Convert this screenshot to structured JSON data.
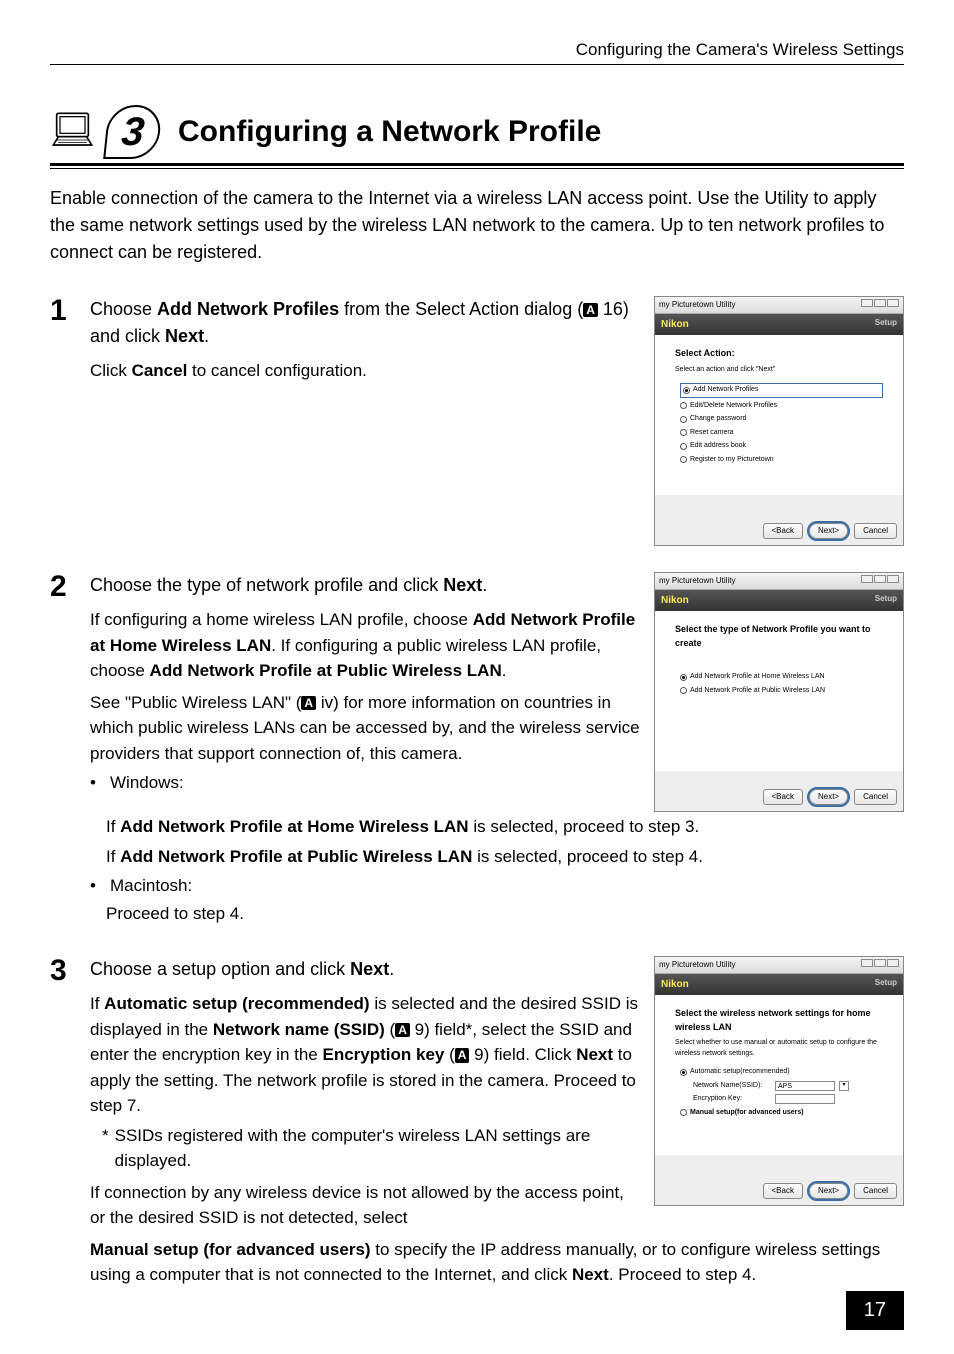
{
  "page_header": "Configuring the Camera's Wireless Settings",
  "page_number": "17",
  "chapter_number": "3",
  "chapter_title": "Configuring a Network Profile",
  "intro": "Enable connection of the camera to the Internet via a wireless LAN access point. Use the Utility to apply the same network settings used by the wireless LAN network to the camera. Up to ten network profiles to connect can be registered.",
  "steps": {
    "s1": {
      "num": "1",
      "title_pre": "Choose ",
      "title_bold1": "Add Network Profiles",
      "title_mid": " from the Select Action dialog (",
      "title_ref": "16",
      "title_post": ") and click ",
      "title_bold2": "Next",
      "title_end": ".",
      "line2_pre": "Click ",
      "line2_bold": "Cancel",
      "line2_post": " to cancel configuration."
    },
    "s2": {
      "num": "2",
      "title_pre": "Choose the type of network profile and click ",
      "title_bold": "Next",
      "title_end": ".",
      "p1_pre": "If configuring a home wireless LAN profile, choose ",
      "p1_b1": "Add Network Profile at Home Wireless LAN",
      "p1_mid": ". If configuring a public wireless LAN profile, choose ",
      "p1_b2": "Add Network Profile at Public Wireless LAN",
      "p1_end": ".",
      "p2_pre": "See \"Public Wireless LAN\" (",
      "p2_ref": "iv",
      "p2_post": ") for more information on countries in which public wireless LANs can be accessed by, and the wireless service providers that support connection of, this camera.",
      "bullet_win": "Windows:",
      "win_l1_pre": "If ",
      "win_l1_b": "Add Network Profile at Home Wireless LAN",
      "win_l1_post": " is selected, proceed to step 3.",
      "win_l2_pre": "If ",
      "win_l2_b": "Add Network Profile at Public Wireless LAN",
      "win_l2_post": " is selected, proceed to step 4.",
      "bullet_mac": "Macintosh:",
      "mac_l1": "Proceed to step 4."
    },
    "s3": {
      "num": "3",
      "title_pre": "Choose a setup option and click ",
      "title_bold": "Next",
      "title_end": ".",
      "p1_pre": "If ",
      "p1_b1": "Automatic setup (recommended)",
      "p1_mid1": " is selected and the desired SSID is displayed in the ",
      "p1_b2": "Network name (SSID)",
      "p1_mid2": " (",
      "p1_ref1": "9",
      "p1_mid3": ") field*, select the SSID and enter the encryption key in the ",
      "p1_b3": "Encryption key",
      "p1_mid4": " (",
      "p1_ref2": "9",
      "p1_mid5": ") field. Click ",
      "p1_b4": "Next",
      "p1_end": " to apply the setting. The network profile is stored in the camera. Proceed to step 7.",
      "footnote_star": "*",
      "footnote": "SSIDs registered with the computer's wireless LAN settings are displayed.",
      "p2_pre": "If connection by any wireless device is not allowed by the access point, or the desired SSID is not detected, select ",
      "p2_b1": "Manual setup (for advanced users)",
      "p2_mid": " to specify the IP address manually, or to configure wireless settings using a computer that is not connected to the Internet, and click ",
      "p2_b2": "Next",
      "p2_end": ". Proceed to step 4."
    }
  },
  "screenshots": {
    "ss1": {
      "window_title": "my Picturetown Utility",
      "brand": "Nikon",
      "setup_label": "Setup",
      "heading": "Select Action:",
      "subheading": "Select an action and click \"Next\"",
      "options": [
        {
          "label": "Add Network Profiles",
          "checked": true,
          "highlighted": true
        },
        {
          "label": "Edit/Delete Network Profiles",
          "checked": false
        },
        {
          "label": "Change password",
          "checked": false
        },
        {
          "label": "Reset camera",
          "checked": false
        },
        {
          "label": "Edit address book",
          "checked": false
        },
        {
          "label": "Register to my Picturetown",
          "checked": false
        }
      ],
      "back": "<Back",
      "next": "Next>",
      "cancel": "Cancel"
    },
    "ss2": {
      "window_title": "my Picturetown Utility",
      "brand": "Nikon",
      "setup_label": "Setup",
      "heading": "Select the type of Network Profile you want to create",
      "options": [
        {
          "label": "Add Network Profile at Home Wireless LAN",
          "checked": true
        },
        {
          "label": "Add Network Profile at Public Wireless LAN",
          "checked": false
        }
      ],
      "back": "<Back",
      "next": "Next>",
      "cancel": "Cancel"
    },
    "ss3": {
      "window_title": "my Picturetown Utility",
      "brand": "Nikon",
      "setup_label": "Setup",
      "heading": "Select the wireless network settings for home wireless LAN",
      "subheading": "Select whether to use manual or automatic setup to configure the wireless network settings.",
      "opt_auto": "Automatic setup(recommended)",
      "label_ssid": "Network Name(SSID):",
      "value_ssid": "APS",
      "label_key": "Encryption Key:",
      "opt_manual": "Manual setup(for advanced users)",
      "back": "<Back",
      "next": "Next>",
      "cancel": "Cancel"
    }
  }
}
